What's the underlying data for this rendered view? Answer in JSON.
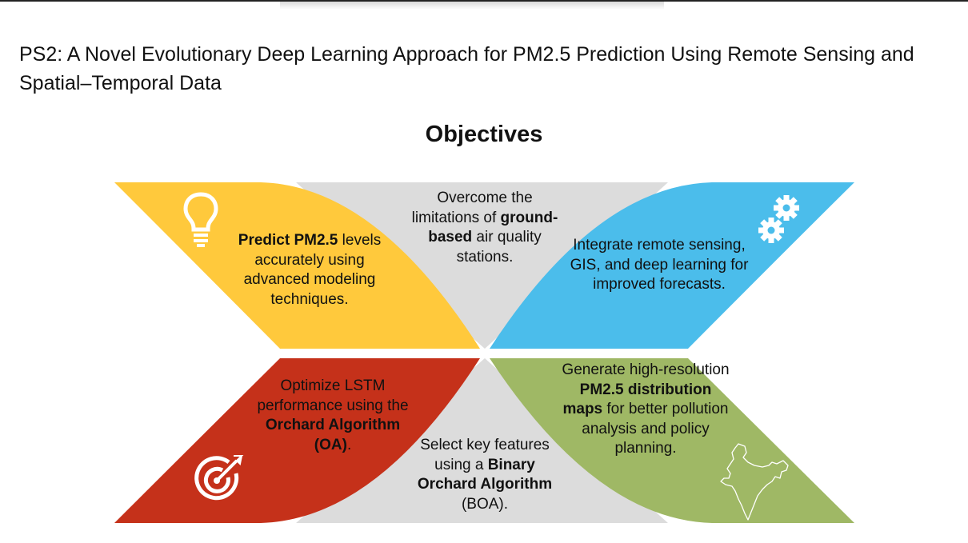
{
  "title": "PS2:  A Novel Evolutionary Deep Learning Approach for PM2.5 Prediction Using Remote Sensing and Spatial–Temporal Data",
  "heading": "Objectives",
  "colors": {
    "yellow": "#FFC93C",
    "blue": "#4BBDEB",
    "red": "#C5311A",
    "green": "#9FB865",
    "gray": "#DCDCDC"
  },
  "objectives": {
    "top_left": {
      "icon": "lightbulb-icon",
      "bold_lead": "Predict PM2.5",
      "rest": " levels accurately using advanced modeling techniques."
    },
    "top_center": {
      "pre": "Overcome the limitations of ",
      "bold": "ground-based",
      "post": " air quality stations."
    },
    "top_right": {
      "icon": "gears-icon",
      "text": "Integrate remote sensing, GIS, and deep learning for improved forecasts."
    },
    "bottom_left": {
      "icon": "target-icon",
      "pre": "Optimize LSTM performance using the ",
      "bold": "Orchard Algorithm (OA)",
      "post": "."
    },
    "bottom_center": {
      "pre": "Select key features using a ",
      "bold": "Binary Orchard Algorithm",
      "post": " (BOA)."
    },
    "bottom_right": {
      "icon": "india-map-icon",
      "pre": "Generate high-resolution ",
      "bold": "PM2.5 distribution maps",
      "post": " for better pollution analysis and policy planning."
    }
  }
}
